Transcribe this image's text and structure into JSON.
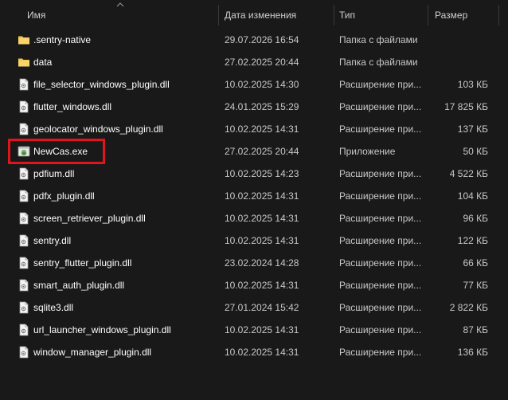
{
  "columns": {
    "name": "Имя",
    "date": "Дата изменения",
    "type": "Тип",
    "size": "Размер"
  },
  "files": [
    {
      "name": ".sentry-native",
      "date": "29.07.2026 16:54",
      "type": "Папка с файлами",
      "size": "",
      "icon": "folder-icon"
    },
    {
      "name": "data",
      "date": "27.02.2025 20:44",
      "type": "Папка с файлами",
      "size": "",
      "icon": "folder-icon"
    },
    {
      "name": "file_selector_windows_plugin.dll",
      "date": "10.02.2025 14:30",
      "type": "Расширение при...",
      "size": "103 КБ",
      "icon": "dll-file-icon"
    },
    {
      "name": "flutter_windows.dll",
      "date": "24.01.2025 15:29",
      "type": "Расширение при...",
      "size": "17 825 КБ",
      "icon": "dll-file-icon"
    },
    {
      "name": "geolocator_windows_plugin.dll",
      "date": "10.02.2025 14:31",
      "type": "Расширение при...",
      "size": "137 КБ",
      "icon": "dll-file-icon"
    },
    {
      "name": "NewCas.exe",
      "date": "27.02.2025 20:44",
      "type": "Приложение",
      "size": "50 КБ",
      "icon": "app-exe-icon"
    },
    {
      "name": "pdfium.dll",
      "date": "10.02.2025 14:23",
      "type": "Расширение при...",
      "size": "4 522 КБ",
      "icon": "dll-file-icon"
    },
    {
      "name": "pdfx_plugin.dll",
      "date": "10.02.2025 14:31",
      "type": "Расширение при...",
      "size": "104 КБ",
      "icon": "dll-file-icon"
    },
    {
      "name": "screen_retriever_plugin.dll",
      "date": "10.02.2025 14:31",
      "type": "Расширение при...",
      "size": "96 КБ",
      "icon": "dll-file-icon"
    },
    {
      "name": "sentry.dll",
      "date": "10.02.2025 14:31",
      "type": "Расширение при...",
      "size": "122 КБ",
      "icon": "dll-file-icon"
    },
    {
      "name": "sentry_flutter_plugin.dll",
      "date": "23.02.2024 14:28",
      "type": "Расширение при...",
      "size": "66 КБ",
      "icon": "dll-file-icon"
    },
    {
      "name": "smart_auth_plugin.dll",
      "date": "10.02.2025 14:31",
      "type": "Расширение при...",
      "size": "77 КБ",
      "icon": "dll-file-icon"
    },
    {
      "name": "sqlite3.dll",
      "date": "27.01.2024 15:42",
      "type": "Расширение при...",
      "size": "2 822 КБ",
      "icon": "dll-file-icon"
    },
    {
      "name": "url_launcher_windows_plugin.dll",
      "date": "10.02.2025 14:31",
      "type": "Расширение при...",
      "size": "87 КБ",
      "icon": "dll-file-icon"
    },
    {
      "name": "window_manager_plugin.dll",
      "date": "10.02.2025 14:31",
      "type": "Расширение при...",
      "size": "136 КБ",
      "icon": "dll-file-icon"
    }
  ],
  "highlighted_file": "NewCas.exe",
  "colors": {
    "background": "#191919",
    "highlight": "#e0141c",
    "folder": "#f5c542"
  }
}
